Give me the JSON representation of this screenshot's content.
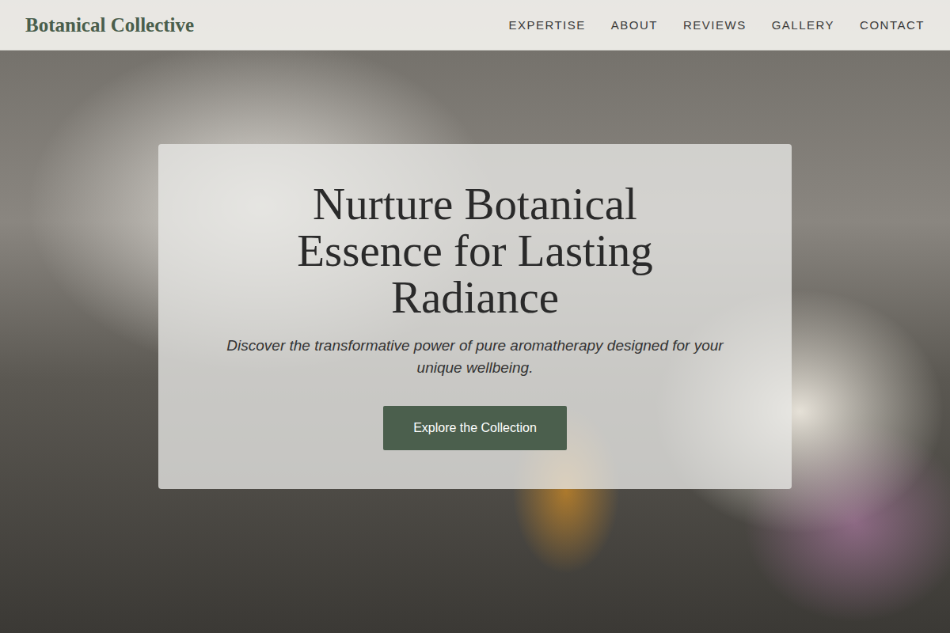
{
  "header": {
    "brand": "Botanical Collective",
    "nav": [
      {
        "label": "EXPERTISE"
      },
      {
        "label": "ABOUT"
      },
      {
        "label": "REVIEWS"
      },
      {
        "label": "GALLERY"
      },
      {
        "label": "CONTACT"
      }
    ]
  },
  "hero": {
    "title": "Nurture Botanical Essence for Lasting Radiance",
    "subtitle": "Discover the transformative power of pure aromatherapy designed for your unique wellbeing.",
    "button": "Explore the Collection"
  }
}
